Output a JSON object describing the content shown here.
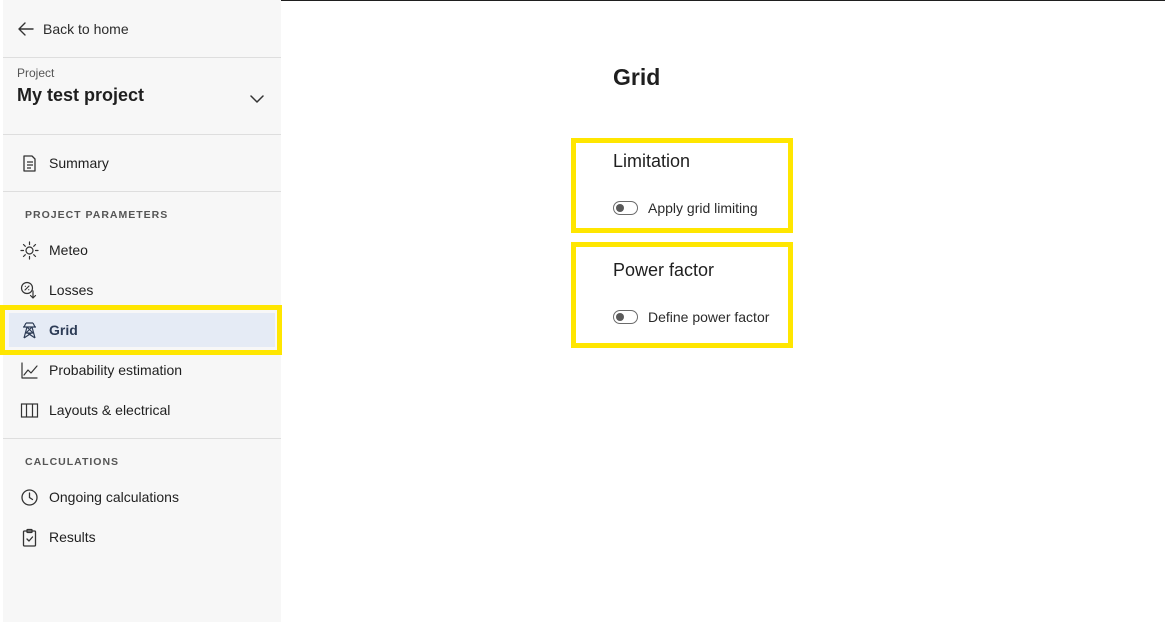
{
  "sidebar": {
    "back_label": "Back to home",
    "project_label": "Project",
    "project_name": "My test project",
    "summary_label": "Summary",
    "section_params": "PROJECT PARAMETERS",
    "params_items": [
      {
        "label": "Meteo",
        "icon": "sun-icon"
      },
      {
        "label": "Losses",
        "icon": "losses-icon"
      },
      {
        "label": "Grid",
        "icon": "pylon-icon",
        "active": true
      },
      {
        "label": "Probability estimation",
        "icon": "line-chart-icon"
      },
      {
        "label": "Layouts & electrical",
        "icon": "columns-icon"
      }
    ],
    "section_calc": "CALCULATIONS",
    "calc_items": [
      {
        "label": "Ongoing calculations",
        "icon": "clock-icon"
      },
      {
        "label": "Results",
        "icon": "clipboard-check-icon"
      }
    ]
  },
  "main": {
    "title": "Grid",
    "groups": [
      {
        "title": "Limitation",
        "toggle_label": "Apply grid limiting",
        "toggle_on": false
      },
      {
        "title": "Power factor",
        "toggle_label": "Define power factor",
        "toggle_on": false
      }
    ]
  },
  "colors": {
    "highlight": "#ffe600",
    "active_bg": "#e5ebf5",
    "sidebar_bg": "#f7f7f7"
  }
}
